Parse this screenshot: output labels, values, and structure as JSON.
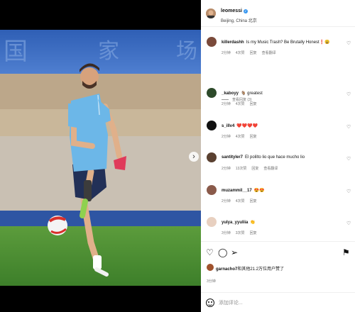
{
  "post": {
    "username": "leomessi",
    "location": "Beijing, China 北京",
    "date": "3分钟"
  },
  "comments": [
    {
      "user": "killerdashh",
      "text": "Is my Music Trash? Be Brutally Honest❗😩",
      "time": "2分钟",
      "likes": "4次赞",
      "reply": "回复",
      "translate": "查看翻译"
    },
    {
      "user": "_kaboyy",
      "text": "🐐 greatest",
      "time": "2分钟",
      "likes": "4次赞",
      "reply": "回复",
      "translate": ""
    },
    {
      "user": "s_illv4",
      "text": "❤️❤️❤️❤️",
      "time": "2分钟",
      "likes": "4次赞",
      "reply": "回复",
      "translate": ""
    },
    {
      "user": "santityler7",
      "text": "El polilto lio que hace mucho lio",
      "time": "2分钟",
      "likes": "13次赞",
      "reply": "回复",
      "translate": "查看翻译"
    },
    {
      "user": "muzammil__17",
      "text": "😍😍",
      "time": "2分钟",
      "likes": "4次赞",
      "reply": "回复",
      "translate": ""
    },
    {
      "user": "yulya_yyuliia",
      "text": "👏",
      "time": "3分钟",
      "likes": "3次赞",
      "reply": "回复",
      "translate": ""
    }
  ],
  "view_replies": "查看回复 (3)",
  "liked_by": {
    "user": "garnacho7",
    "text": "和其他21.2万位用户赞了"
  },
  "add_comment": {
    "placeholder": "添加评论..."
  },
  "icons": {
    "heart": "heart-icon",
    "comment": "comment-icon",
    "share": "share-icon",
    "save": "bookmark-icon",
    "emoji": "emoji-icon",
    "next": "chevron-right-icon"
  },
  "colors": {
    "jersey": "#6cb7e8",
    "pitch": "#3f8a2b",
    "boots": "#8fd14f",
    "verified": "#3897f0"
  }
}
